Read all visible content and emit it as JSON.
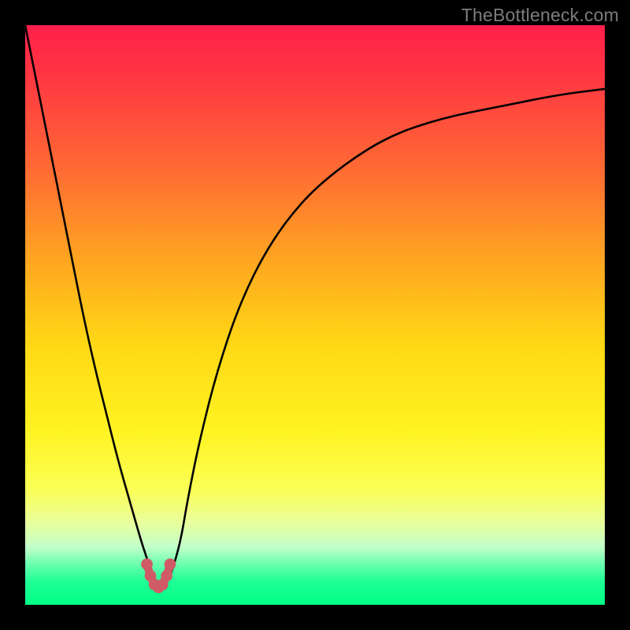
{
  "watermark": {
    "text": "TheBottleneck.com"
  },
  "colors": {
    "background": "#000000",
    "curve": "#000000",
    "marker": "#cf5b67",
    "gradient_stops": [
      {
        "offset": 0.0,
        "color": "#ff1f4a"
      },
      {
        "offset": 0.1,
        "color": "#ff3a41"
      },
      {
        "offset": 0.25,
        "color": "#ff6b33"
      },
      {
        "offset": 0.4,
        "color": "#ffa321"
      },
      {
        "offset": 0.55,
        "color": "#ffd815"
      },
      {
        "offset": 0.7,
        "color": "#fff322"
      },
      {
        "offset": 0.8,
        "color": "#faff55"
      },
      {
        "offset": 0.86,
        "color": "#e8ff9e"
      },
      {
        "offset": 0.9,
        "color": "#c2ffca"
      },
      {
        "offset": 0.93,
        "color": "#6affae"
      },
      {
        "offset": 0.96,
        "color": "#1eff95"
      },
      {
        "offset": 1.0,
        "color": "#00ff85"
      }
    ]
  },
  "chart_data": {
    "type": "line",
    "title": "",
    "xlabel": "",
    "ylabel": "",
    "xlim": [
      0,
      100
    ],
    "ylim": [
      0,
      100
    ],
    "grid": false,
    "series": [
      {
        "name": "bottleneck-curve",
        "x": [
          0,
          2,
          4,
          6,
          8,
          10,
          12,
          14,
          16,
          18,
          20,
          21,
          22,
          23,
          24,
          25,
          26,
          27,
          28,
          30,
          33,
          37,
          42,
          48,
          55,
          63,
          72,
          82,
          92,
          100
        ],
        "y": [
          100,
          90,
          80,
          70,
          60,
          50,
          41,
          33,
          25,
          18,
          11,
          8,
          5,
          3,
          3,
          5,
          8,
          12,
          18,
          28,
          40,
          52,
          62,
          70,
          76,
          81,
          84,
          86,
          88,
          89
        ]
      }
    ],
    "markers": {
      "name": "bottleneck-minimum",
      "x": [
        21.0,
        21.6,
        22.3,
        23.0,
        23.7,
        24.4,
        25.0
      ],
      "y": [
        7.0,
        5.0,
        3.5,
        3.0,
        3.5,
        5.0,
        7.0
      ]
    }
  }
}
